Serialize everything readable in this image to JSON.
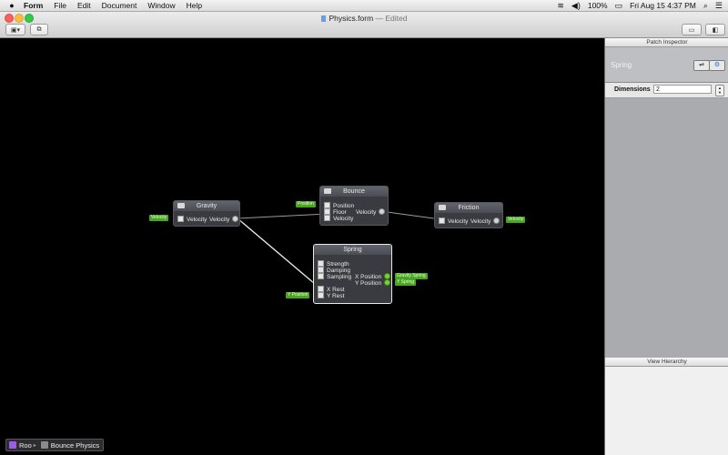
{
  "menubar": {
    "apple": "",
    "items": [
      "Form",
      "File",
      "Edit",
      "Document",
      "Window",
      "Help"
    ],
    "battery": "100%",
    "clock": "Fri Aug 15  4:37 PM"
  },
  "window": {
    "title": "Physics.form",
    "edited": "— Edited"
  },
  "nodes": {
    "gravity": {
      "title": "Gravity",
      "in_label": "Velocity",
      "out_label": "Velocity",
      "tag_in": "Velocity"
    },
    "bounce": {
      "title": "Bounce",
      "inputs": [
        "Position",
        "Floor",
        "Velocity"
      ],
      "out_label": "Velocity",
      "tag_in": "Position"
    },
    "friction": {
      "title": "Friction",
      "in_label": "Velocity",
      "out_label": "Velocity",
      "tag_out": "Velocity"
    },
    "spring": {
      "title": "Spring",
      "inputs": [
        "Strength",
        "Damping",
        "Sampling",
        "X Rest",
        "Y Rest"
      ],
      "outputs": [
        "X Position",
        "Y Position"
      ],
      "tag_in": "Y Position",
      "tag_out_1": "Gravity Spring",
      "tag_out_2": "Y Spring"
    }
  },
  "inspector": {
    "header": "Patch Inspector",
    "patch_name": "Spring",
    "dimensions_label": "Dimensions",
    "dimensions_value": "2",
    "hierarchy_header": "View Hierarchy"
  },
  "breadcrumb": {
    "root": "Roo",
    "current": "Bounce Physics"
  },
  "colors": {
    "tag_green": "#4aa520",
    "canvas": "#000000",
    "inspector_bg": "#a9abae"
  }
}
